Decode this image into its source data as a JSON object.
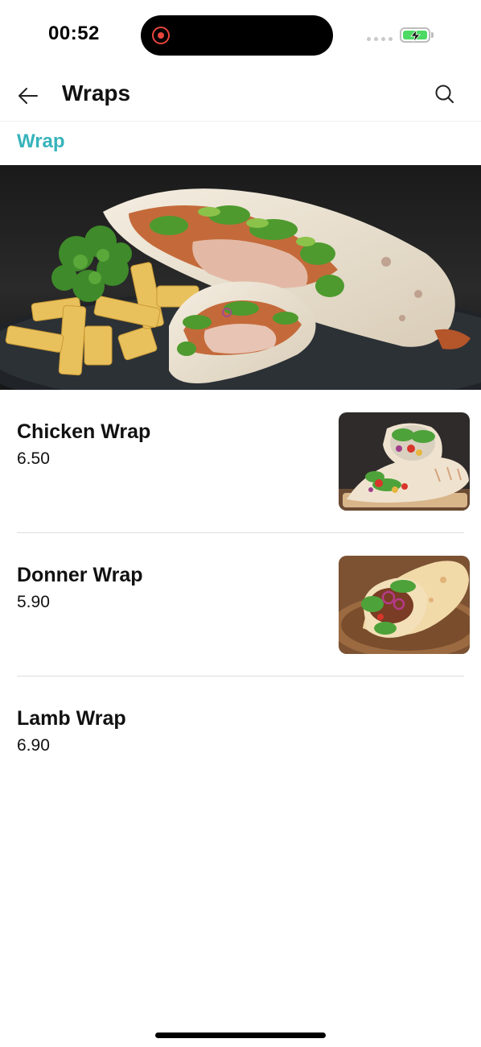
{
  "status_bar": {
    "time": "00:52",
    "icons": [
      "screen-recording-icon",
      "cellular-signal-icon",
      "battery-charging-icon"
    ],
    "battery_level": 1.0,
    "battery_color": "#4cd964",
    "recording_color": "#e8453c"
  },
  "header": {
    "title": "Wraps",
    "back_icon": "back-arrow-icon",
    "search_icon": "search-icon"
  },
  "section": {
    "title": "Wrap",
    "title_color": "#37b3bb"
  },
  "hero": {
    "image": "wrap-with-fries-photo"
  },
  "items": [
    {
      "name": "Chicken Wrap",
      "price": "6.50",
      "image": "chicken-wrap-photo"
    },
    {
      "name": "Donner Wrap",
      "price": "5.90",
      "image": "donner-wrap-photo"
    },
    {
      "name": "Lamb Wrap",
      "price": "6.90"
    }
  ]
}
